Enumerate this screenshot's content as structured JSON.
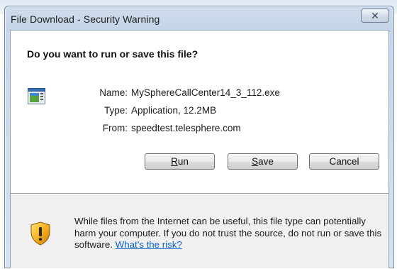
{
  "window": {
    "title": "File Download - Security Warning",
    "close_symbol": "✕"
  },
  "dialog": {
    "question": "Do you want to run or save this file?",
    "file_icon": "executable-file-icon",
    "fields": [
      {
        "label": "Name:",
        "value": "MySphereCallCenter14_3_112.exe"
      },
      {
        "label": "Type:",
        "value": "Application, 12.2MB"
      },
      {
        "label": "From:",
        "value": "speedtest.telesphere.com"
      }
    ],
    "buttons": {
      "run_underline": "R",
      "run_rest": "un",
      "save_underline": "S",
      "save_rest": "ave",
      "cancel": "Cancel"
    }
  },
  "warning": {
    "icon": "shield-warning-icon",
    "text": "While files from the Internet can be useful, this file type can potentially harm your computer. If you do not trust the source, do not run or save this software.",
    "link_text": "What's the risk?"
  },
  "colors": {
    "link": "#0b62c4",
    "footer_bg": "#f0f0f0",
    "frame": "#c6d6e8"
  }
}
